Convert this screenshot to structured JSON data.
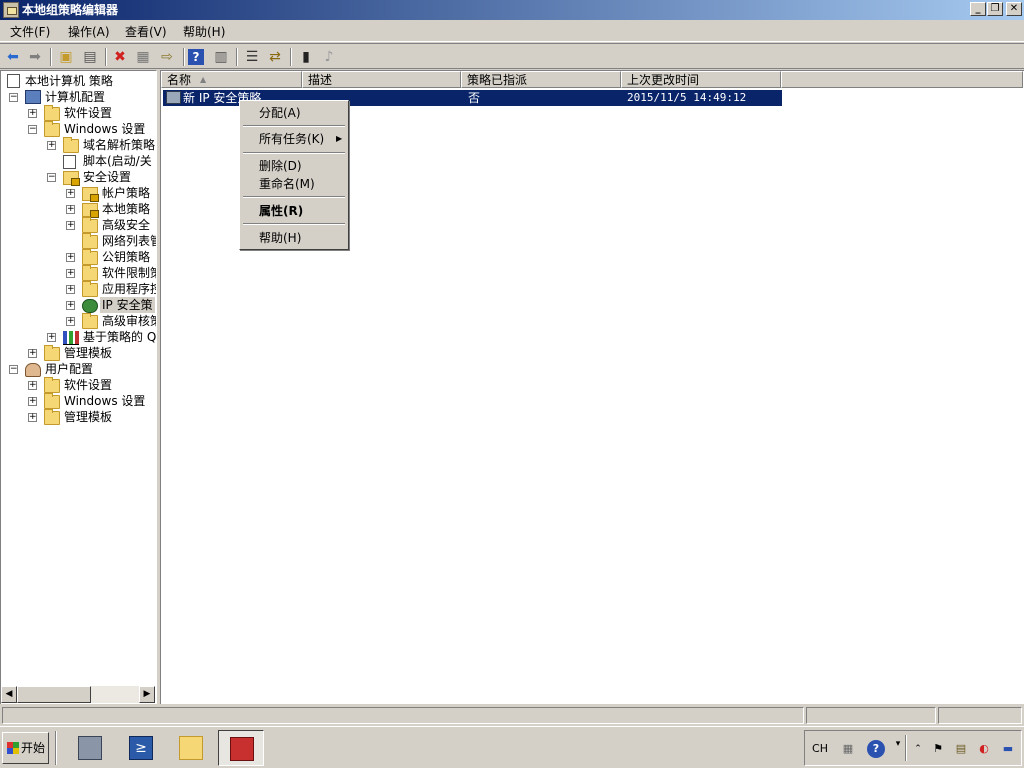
{
  "window": {
    "title": "本地组策略编辑器",
    "controls": {
      "minimize": "_",
      "restore": "❐",
      "close": "✕"
    }
  },
  "menubar": [
    "文件(F)",
    "操作(A)",
    "查看(V)",
    "帮助(H)"
  ],
  "toolbar": {
    "icons": [
      "back-icon",
      "forward-icon",
      "up-folder-icon",
      "show-hide-tree-icon",
      "delete-icon",
      "properties-icon",
      "export-list-icon",
      "help-icon",
      "show-hide-action-pane-icon",
      "manage-filter-icon",
      "assign-icon",
      "unassign-icon",
      "not-assign-icon"
    ]
  },
  "tree": {
    "root": "本地计算机 策略",
    "items": [
      {
        "label": "计算机配置"
      },
      {
        "label": "软件设置"
      },
      {
        "label": "Windows 设置"
      },
      {
        "label": "域名解析策略"
      },
      {
        "label": "脚本(启动/关"
      },
      {
        "label": "安全设置"
      },
      {
        "label": "帐户策略"
      },
      {
        "label": "本地策略"
      },
      {
        "label": "高级安全"
      },
      {
        "label": "网络列表管"
      },
      {
        "label": "公钥策略"
      },
      {
        "label": "软件限制策"
      },
      {
        "label": "应用程序控"
      },
      {
        "label": "IP 安全策"
      },
      {
        "label": "高级审核策"
      },
      {
        "label": "基于策略的 Q"
      },
      {
        "label": "管理模板"
      },
      {
        "label": "用户配置"
      },
      {
        "label": "软件设置"
      },
      {
        "label": "Windows 设置"
      },
      {
        "label": "管理模板"
      }
    ]
  },
  "list": {
    "columns": [
      "名称",
      "描述",
      "策略已指派",
      "上次更改时间"
    ],
    "rows": [
      {
        "name": "新 IP 安全策略",
        "description": "",
        "assigned": "否",
        "last_modified": "2015/11/5 14:49:12"
      }
    ]
  },
  "context_menu": {
    "items": [
      "分配(A)",
      "所有任务(K)",
      "删除(D)",
      "重命名(M)",
      "属性(R)",
      "帮助(H)"
    ]
  },
  "taskbar": {
    "start_label": "开始",
    "tray": {
      "language": "CH"
    }
  },
  "colors": {
    "title_gradient_start": "#0a246a",
    "title_gradient_end": "#a6caf0",
    "selection": "#0a246a",
    "face": "#d4d0c8"
  }
}
